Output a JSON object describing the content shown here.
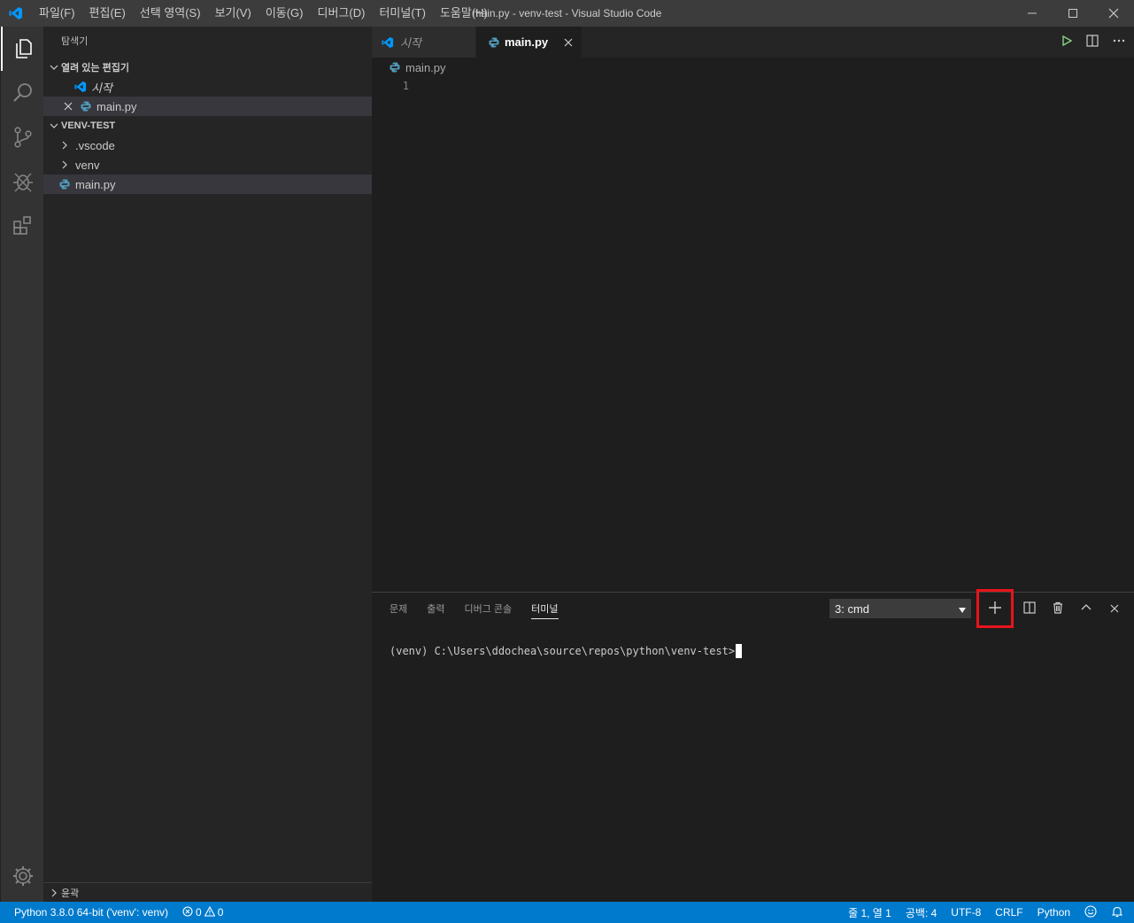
{
  "window": {
    "title": "main.py - venv-test - Visual Studio Code",
    "menu": [
      "파일(F)",
      "편집(E)",
      "선택 영역(S)",
      "보기(V)",
      "이동(G)",
      "디버그(D)",
      "터미널(T)",
      "도움말(H)"
    ]
  },
  "sidebar": {
    "title": "탐색기",
    "open_editors": {
      "label": "열려 있는 편집기",
      "items": [
        "시작",
        "main.py"
      ]
    },
    "folder": {
      "label": "VENV-TEST",
      "items": [
        ".vscode",
        "venv",
        "main.py"
      ]
    },
    "outline": "윤곽"
  },
  "editor": {
    "tabs": [
      "시작",
      "main.py"
    ],
    "breadcrumb": "main.py",
    "line_number": "1"
  },
  "panel": {
    "tabs": [
      "문제",
      "출력",
      "디버그 콘솔",
      "터미널"
    ],
    "terminal_select": "3: cmd",
    "terminal_prompt": "(venv) C:\\Users\\ddochea\\source\\repos\\python\\venv-test>"
  },
  "statusbar": {
    "interpreter": "Python 3.8.0 64-bit ('venv': venv)",
    "errors": "0",
    "warnings": "0",
    "position": "줄 1, 열 1",
    "spaces": "공백: 4",
    "encoding": "UTF-8",
    "eol": "CRLF",
    "language": "Python"
  },
  "colors": {
    "accent": "#007acc",
    "highlight": "#e8141b",
    "python_icon": "#519aba",
    "vscode_icon": "#0098ff"
  }
}
